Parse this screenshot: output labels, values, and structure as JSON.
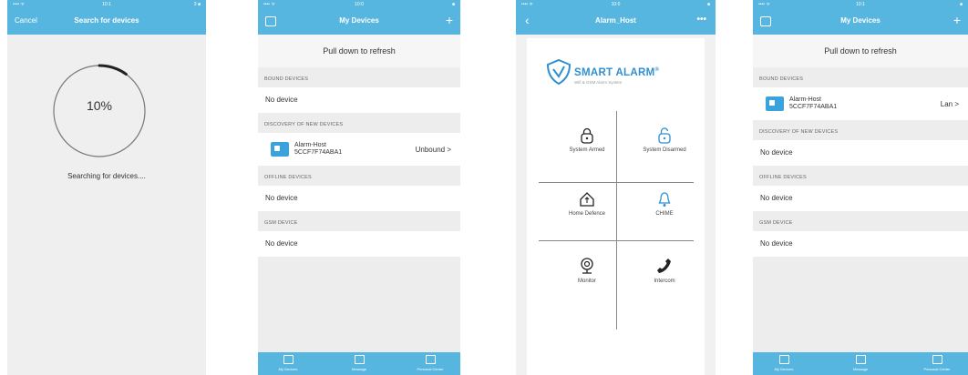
{
  "screen1": {
    "status": {
      "left": "•••• ᯤ",
      "center": "10:1",
      "right": "3 ■"
    },
    "nav": {
      "cancel": "Cancel",
      "title": "Search for devices"
    },
    "progress": {
      "label": "10%",
      "fraction": 0.1
    },
    "searching_text": "Searching for devices...."
  },
  "screen2": {
    "status": {
      "left": "•••• ᯤ",
      "center": "10:0",
      "right": "■"
    },
    "nav": {
      "title": "My Devices",
      "add": "+"
    },
    "pull": "Pull down to refresh",
    "bound_header": "BOUND DEVICES",
    "bound_empty": "No device",
    "discovery_header": "DISCOVERY OF NEW DEVICES",
    "device": {
      "name": "Alarm-Host",
      "id": "5CCF7F74ABA1",
      "status": "Unbound >"
    },
    "offline_header": "OFFLINE DEVICES",
    "offline_empty": "No device",
    "gsm_header": "GSM DEVICE",
    "gsm_empty": "No device",
    "tabs": [
      "My Devices",
      "Message",
      "Personal Center"
    ]
  },
  "screen3": {
    "status": {
      "left": "•••• ᯤ",
      "center": "10:0",
      "right": "■"
    },
    "nav": {
      "back": "‹",
      "title": "Alarm_Host",
      "more": "•••"
    },
    "brand": "SMART ALARM",
    "registered": "®",
    "tagline": "Wifi & GSM Alarm System",
    "buttons": [
      "System Armed",
      "System Disarmed",
      "Home Defence",
      "CHIME",
      "Monitor",
      "Intercom"
    ]
  },
  "screen4": {
    "status": {
      "left": "•••• ᯤ",
      "center": "10:1",
      "right": "■"
    },
    "nav": {
      "title": "My Devices",
      "add": "+"
    },
    "pull": "Pull down to refresh",
    "bound_header": "BOUND DEVICES",
    "device": {
      "name": "Alarm-Host",
      "id": "5CCF7F74ABA1",
      "status": "Lan >"
    },
    "discovery_header": "DISCOVERY OF NEW DEVICES",
    "discovery_empty": "No device",
    "offline_header": "OFFLINE DEVICES",
    "offline_empty": "No device",
    "gsm_header": "GSM DEVICE",
    "gsm_empty": "No device",
    "tabs": [
      "My Devices",
      "Message",
      "Personal Center"
    ]
  },
  "colors": {
    "accent": "#57b6df",
    "device_icon": "#3aa3de",
    "brand": "#2f8fd1"
  }
}
